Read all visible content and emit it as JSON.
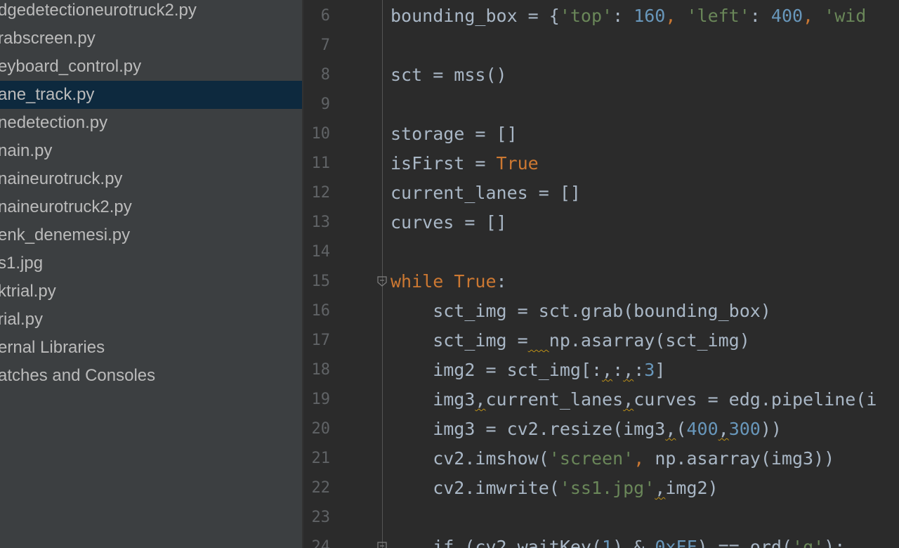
{
  "project_tree": {
    "files": [
      {
        "label": "dgedetectioneurotruck2.py",
        "selected": false
      },
      {
        "label": "rabscreen.py",
        "selected": false
      },
      {
        "label": "eyboard_control.py",
        "selected": false
      },
      {
        "label": "ane_track.py",
        "selected": true
      },
      {
        "label": "nedetection.py",
        "selected": false
      },
      {
        "label": "nain.py",
        "selected": false
      },
      {
        "label": "naineurotruck.py",
        "selected": false
      },
      {
        "label": "naineurotruck2.py",
        "selected": false
      },
      {
        "label": "enk_denemesi.py",
        "selected": false
      },
      {
        "label": "s1.jpg",
        "selected": false
      },
      {
        "label": "ktrial.py",
        "selected": false
      },
      {
        "label": "rial.py",
        "selected": false
      },
      {
        "label": "ernal Libraries",
        "selected": false
      },
      {
        "label": "atches and Consoles",
        "selected": false
      }
    ]
  },
  "editor": {
    "colors": {
      "keyword": "#cc7832",
      "string": "#6a8759",
      "number": "#6897bb",
      "plain": "#a9b7c6",
      "line_number": "#606366",
      "warning_underline": "#be9117"
    },
    "lines": [
      {
        "number": "6",
        "tokens": [
          {
            "t": "bounding_box = {",
            "k": "plain"
          },
          {
            "t": "'top'",
            "k": "str"
          },
          {
            "t": ": ",
            "k": "plain"
          },
          {
            "t": "160",
            "k": "num"
          },
          {
            "t": ", ",
            "k": "kw"
          },
          {
            "t": "'left'",
            "k": "str"
          },
          {
            "t": ": ",
            "k": "plain"
          },
          {
            "t": "400",
            "k": "num"
          },
          {
            "t": ", ",
            "k": "kw"
          },
          {
            "t": "'wid",
            "k": "str"
          }
        ]
      },
      {
        "number": "7",
        "tokens": []
      },
      {
        "number": "8",
        "tokens": [
          {
            "t": "sct = mss()",
            "k": "plain"
          }
        ]
      },
      {
        "number": "9",
        "tokens": []
      },
      {
        "number": "10",
        "tokens": [
          {
            "t": "storage = []",
            "k": "plain"
          }
        ]
      },
      {
        "number": "11",
        "tokens": [
          {
            "t": "isFirst = ",
            "k": "plain"
          },
          {
            "t": "True",
            "k": "kw"
          }
        ]
      },
      {
        "number": "12",
        "tokens": [
          {
            "t": "current_lanes = []",
            "k": "plain"
          }
        ]
      },
      {
        "number": "13",
        "tokens": [
          {
            "t": "curves = []",
            "k": "plain"
          }
        ]
      },
      {
        "number": "14",
        "tokens": []
      },
      {
        "number": "15",
        "fold": true,
        "tokens": [
          {
            "t": "while ",
            "k": "kw"
          },
          {
            "t": "True",
            "k": "kw"
          },
          {
            "t": ":",
            "k": "plain"
          }
        ]
      },
      {
        "number": "16",
        "tokens": [
          {
            "t": "    sct_img = sct.grab(bounding_box)",
            "k": "plain"
          }
        ]
      },
      {
        "number": "17",
        "tokens": [
          {
            "t": "    sct_img =",
            "k": "plain"
          },
          {
            "t": "  ",
            "k": "warn"
          },
          {
            "t": "np.asarray(sct_img)",
            "k": "plain"
          }
        ]
      },
      {
        "number": "18",
        "tokens": [
          {
            "t": "    img2 = sct_img[:",
            "k": "plain"
          },
          {
            "t": ",",
            "k": "warn"
          },
          {
            "t": ":",
            "k": "plain"
          },
          {
            "t": ",",
            "k": "warn"
          },
          {
            "t": ":",
            "k": "plain"
          },
          {
            "t": "3",
            "k": "num"
          },
          {
            "t": "]",
            "k": "plain"
          }
        ]
      },
      {
        "number": "19",
        "tokens": [
          {
            "t": "    img3",
            "k": "plain"
          },
          {
            "t": ",",
            "k": "warn"
          },
          {
            "t": "current_lanes",
            "k": "plain"
          },
          {
            "t": ",",
            "k": "warn"
          },
          {
            "t": "curves = edg.pipeline(i",
            "k": "plain"
          }
        ]
      },
      {
        "number": "20",
        "tokens": [
          {
            "t": "    img3 = cv2.resize(img3",
            "k": "plain"
          },
          {
            "t": ",",
            "k": "warn"
          },
          {
            "t": "(",
            "k": "plain"
          },
          {
            "t": "400",
            "k": "num"
          },
          {
            "t": ",",
            "k": "warn"
          },
          {
            "t": "300",
            "k": "num"
          },
          {
            "t": "))",
            "k": "plain"
          }
        ]
      },
      {
        "number": "21",
        "tokens": [
          {
            "t": "    cv2.imshow(",
            "k": "plain"
          },
          {
            "t": "'screen'",
            "k": "str"
          },
          {
            "t": ", ",
            "k": "kw"
          },
          {
            "t": "np.asarray(img3))",
            "k": "plain"
          }
        ]
      },
      {
        "number": "22",
        "tokens": [
          {
            "t": "    cv2.imwrite(",
            "k": "plain"
          },
          {
            "t": "'ss1.jpg'",
            "k": "str"
          },
          {
            "t": ",",
            "k": "warn"
          },
          {
            "t": "img2)",
            "k": "plain"
          }
        ]
      },
      {
        "number": "23",
        "tokens": []
      },
      {
        "number": "24",
        "fold": true,
        "tokens": [
          {
            "t": "    if (cv2.waitKey(",
            "k": "plain"
          },
          {
            "t": "1",
            "k": "num"
          },
          {
            "t": ") & ",
            "k": "plain"
          },
          {
            "t": "0xFF",
            "k": "num"
          },
          {
            "t": ") == ord(",
            "k": "plain"
          },
          {
            "t": "'q'",
            "k": "str"
          },
          {
            "t": "):",
            "k": "plain"
          }
        ]
      }
    ]
  }
}
